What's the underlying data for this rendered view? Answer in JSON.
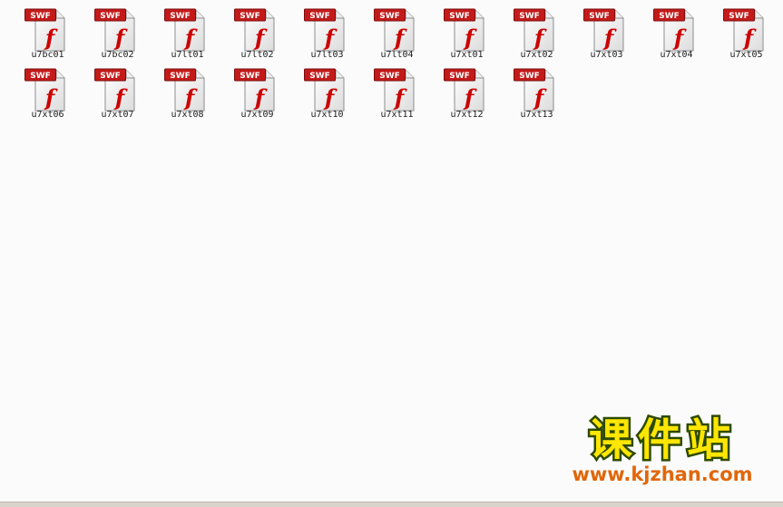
{
  "files": [
    {
      "name": "u7bc01",
      "badge": "SWF",
      "icon": "flash-swf-file-icon"
    },
    {
      "name": "u7bc02",
      "badge": "SWF",
      "icon": "flash-swf-file-icon"
    },
    {
      "name": "u7lt01",
      "badge": "SWF",
      "icon": "flash-swf-file-icon"
    },
    {
      "name": "u7lt02",
      "badge": "SWF",
      "icon": "flash-swf-file-icon"
    },
    {
      "name": "u7lt03",
      "badge": "SWF",
      "icon": "flash-swf-file-icon"
    },
    {
      "name": "u7lt04",
      "badge": "SWF",
      "icon": "flash-swf-file-icon"
    },
    {
      "name": "u7xt01",
      "badge": "SWF",
      "icon": "flash-swf-file-icon"
    },
    {
      "name": "u7xt02",
      "badge": "SWF",
      "icon": "flash-swf-file-icon"
    },
    {
      "name": "u7xt03",
      "badge": "SWF",
      "icon": "flash-swf-file-icon"
    },
    {
      "name": "u7xt04",
      "badge": "SWF",
      "icon": "flash-swf-file-icon"
    },
    {
      "name": "u7xt05",
      "badge": "SWF",
      "icon": "flash-swf-file-icon"
    },
    {
      "name": "u7xt06",
      "badge": "SWF",
      "icon": "flash-swf-file-icon"
    },
    {
      "name": "u7xt07",
      "badge": "SWF",
      "icon": "flash-swf-file-icon"
    },
    {
      "name": "u7xt08",
      "badge": "SWF",
      "icon": "flash-swf-file-icon"
    },
    {
      "name": "u7xt09",
      "badge": "SWF",
      "icon": "flash-swf-file-icon"
    },
    {
      "name": "u7xt10",
      "badge": "SWF",
      "icon": "flash-swf-file-icon"
    },
    {
      "name": "u7xt11",
      "badge": "SWF",
      "icon": "flash-swf-file-icon"
    },
    {
      "name": "u7xt12",
      "badge": "SWF",
      "icon": "flash-swf-file-icon"
    },
    {
      "name": "u7xt13",
      "badge": "SWF",
      "icon": "flash-swf-file-icon"
    }
  ],
  "watermark": {
    "title": "课件站",
    "url": "www.kjzhan.com"
  },
  "colors": {
    "background": "#fbfbfb",
    "badge_red": "#c41a1a",
    "flash_red": "#cc0000",
    "watermark_yellow": "#ffe600",
    "watermark_outline": "#2d4a00",
    "watermark_url": "#e0670a"
  }
}
